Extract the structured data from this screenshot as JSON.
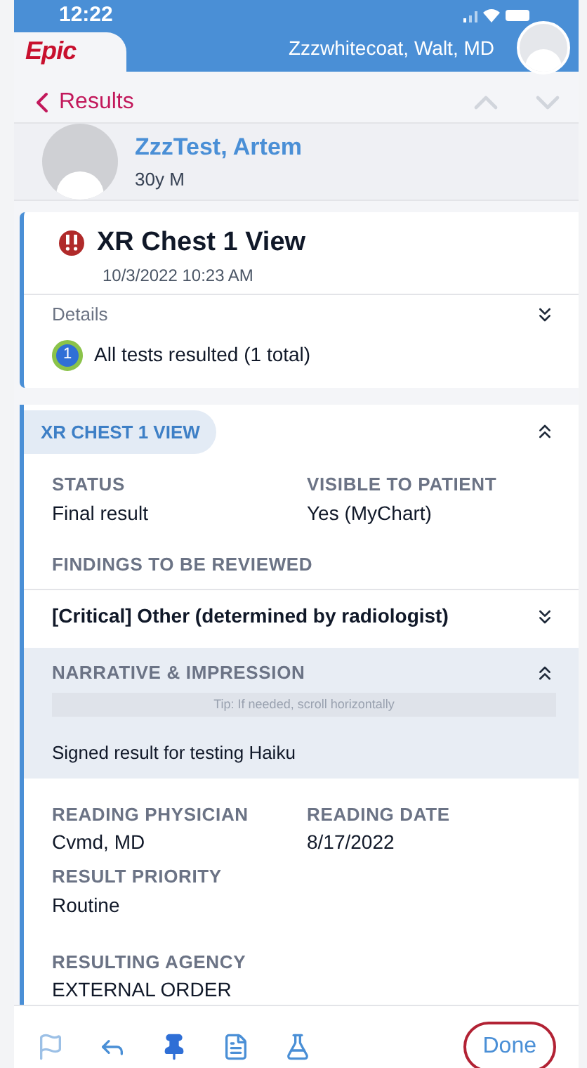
{
  "status_bar": {
    "time": "12:22"
  },
  "header": {
    "logo": "Epic",
    "user": "Zzzwhitecoat, Walt, MD"
  },
  "nav": {
    "back": "Results"
  },
  "patient": {
    "name": "ZzzTest, Artem",
    "info": "30y M"
  },
  "result": {
    "title": "XR Chest 1 View",
    "datetime": "10/3/2022 10:23 AM",
    "details_label": "Details",
    "details_expanded": false,
    "badge": "1",
    "summary": "All tests resulted (1 total)"
  },
  "section": {
    "title": "XR CHEST 1 VIEW",
    "expanded": true,
    "fields": [
      {
        "label": "STATUS",
        "value": "Final result"
      },
      {
        "label": "VISIBLE TO PATIENT",
        "value": "Yes (MyChart)"
      }
    ],
    "findings": {
      "label": "FINDINGS TO BE REVIEWED",
      "item": "[Critical] Other (determined by radiologist)",
      "expanded": false
    },
    "narrative": {
      "title": "NARRATIVE & IMPRESSION",
      "expanded": true,
      "tip": "Tip: If needed, scroll horizontally",
      "text": "Signed result for testing Haiku"
    },
    "fields_after": [
      {
        "label": "READING PHYSICIAN",
        "value": "Cvmd, MD",
        "kind": "half"
      },
      {
        "label": "READING DATE",
        "value": "8/17/2022",
        "kind": "half"
      },
      {
        "label": "RESULT PRIORITY",
        "value": "Routine",
        "kind": "full"
      },
      {
        "label": "RESULTING AGENCY",
        "value": "EXTERNAL ORDER",
        "kind": "full"
      }
    ]
  },
  "toolbar": {
    "done": "Done"
  }
}
